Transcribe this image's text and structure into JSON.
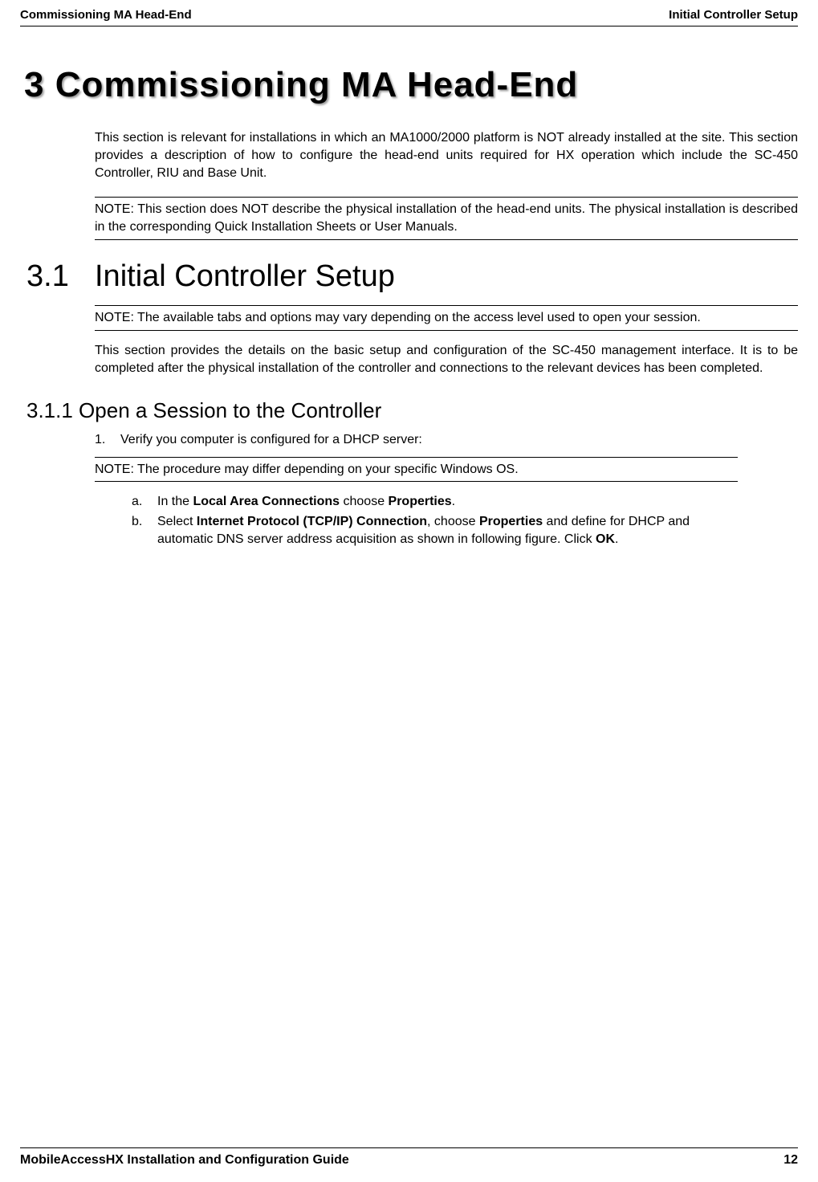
{
  "header": {
    "left": "Commissioning MA Head-End",
    "right": "Initial Controller Setup"
  },
  "chapter_title": "3 Commissioning MA Head-End",
  "intro": "This section is relevant for installations in which an MA1000/2000 platform is NOT already installed at the site. This section provides a description of how to configure the head-end units required for HX operation which include the SC-450 Controller, RIU and Base Unit.",
  "note1": "NOTE: This section does NOT describe the physical installation of the head-end units. The physical installation is described in the corresponding Quick Installation Sheets or User Manuals.",
  "section31": {
    "number": "3.1",
    "title": "Initial Controller Setup"
  },
  "note2": "NOTE: The available tabs and options may vary depending on the access level used to open your session.",
  "body31": "This section provides the details on the basic setup and configuration of the SC-450 management interface. It is to be completed after the physical installation of the controller and connections to the relevant devices has been completed.",
  "section311": "3.1.1 Open a Session to the Controller",
  "step1": {
    "marker": "1.",
    "text": "Verify you computer is configured for a DHCP server:"
  },
  "note3": "NOTE: The procedure may differ depending on your specific Windows OS.",
  "sub_a": {
    "marker": "a.",
    "pre": "In the ",
    "bold1": "Local Area Connections",
    "mid": " choose ",
    "bold2": "Properties",
    "post": "."
  },
  "sub_b": {
    "marker": "b.",
    "pre": "Select ",
    "bold1": "Internet Protocol (TCP/IP) Connection",
    "mid1": ", choose ",
    "bold2": "Properties",
    "mid2": " and define for DHCP and automatic DNS server address acquisition as shown in following figure. Click ",
    "bold3": "OK",
    "post": "."
  },
  "footer": {
    "title": "MobileAccessHX Installation and Configuration Guide",
    "page": "12"
  }
}
